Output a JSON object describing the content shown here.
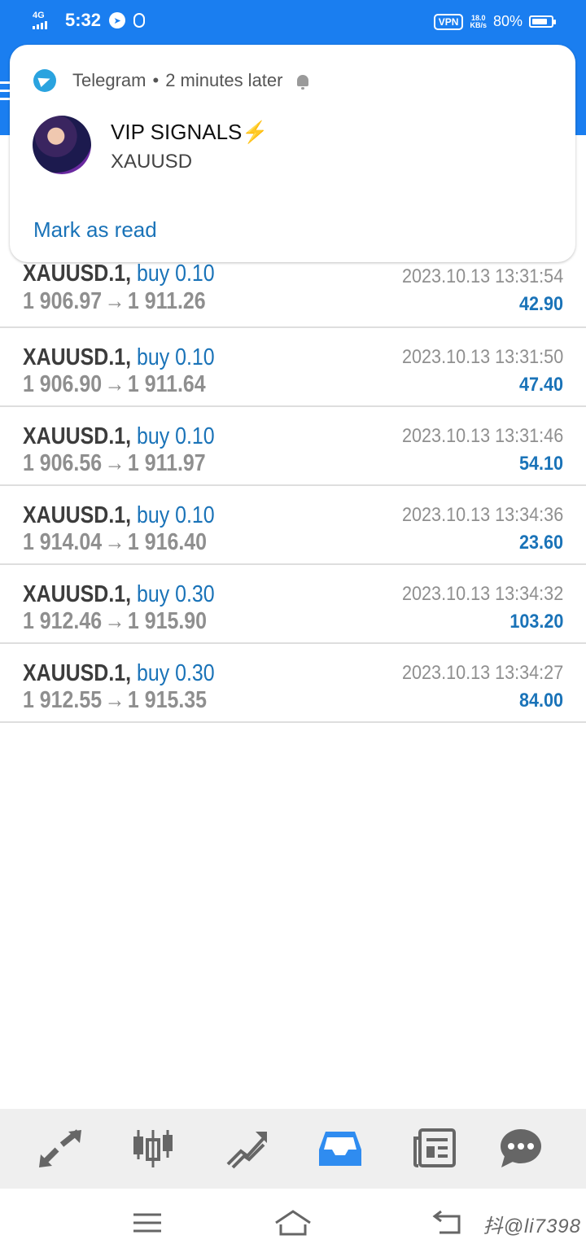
{
  "status_bar": {
    "network": "4G",
    "time": "5:32",
    "vpn": "VPN",
    "speed_value": "18.0",
    "speed_unit": "KB/s",
    "battery": "80%",
    "battery_level": 0.8
  },
  "notification": {
    "app": "Telegram",
    "when": "2 minutes later",
    "title": "VIP SIGNALS⚡",
    "message": "XAUUSD",
    "action": "Mark as read"
  },
  "deals": [
    {
      "symbol": "XAUUSD.1,",
      "side": "buy 0.10",
      "open": "1 906.97",
      "close": "1 911.26",
      "time": "2023.10.13 13:31:54",
      "profit": "42.90"
    },
    {
      "symbol": "XAUUSD.1,",
      "side": "buy 0.10",
      "open": "1 906.90",
      "close": "1 911.64",
      "time": "2023.10.13 13:31:50",
      "profit": "47.40"
    },
    {
      "symbol": "XAUUSD.1,",
      "side": "buy 0.10",
      "open": "1 906.56",
      "close": "1 911.97",
      "time": "2023.10.13 13:31:46",
      "profit": "54.10"
    },
    {
      "symbol": "XAUUSD.1,",
      "side": "buy 0.10",
      "open": "1 914.04",
      "close": "1 916.40",
      "time": "2023.10.13 13:34:36",
      "profit": "23.60"
    },
    {
      "symbol": "XAUUSD.1,",
      "side": "buy 0.30",
      "open": "1 912.46",
      "close": "1 915.90",
      "time": "2023.10.13 13:34:32",
      "profit": "103.20"
    },
    {
      "symbol": "XAUUSD.1,",
      "side": "buy 0.30",
      "open": "1 912.55",
      "close": "1 915.35",
      "time": "2023.10.13 13:34:27",
      "profit": "84.00"
    }
  ],
  "arrow_glyph": "→",
  "tabs": [
    {
      "icon": "quotes-icon"
    },
    {
      "icon": "chart-icon"
    },
    {
      "icon": "trade-icon"
    },
    {
      "icon": "history-icon",
      "active": true
    },
    {
      "icon": "news-icon"
    },
    {
      "icon": "messages-icon"
    }
  ],
  "watermark": "抖@li7398",
  "colors": {
    "header": "#1a7ef0",
    "accent": "#1a73b8",
    "active_tab": "#2f8cf0",
    "inactive_tab": "#666666"
  }
}
